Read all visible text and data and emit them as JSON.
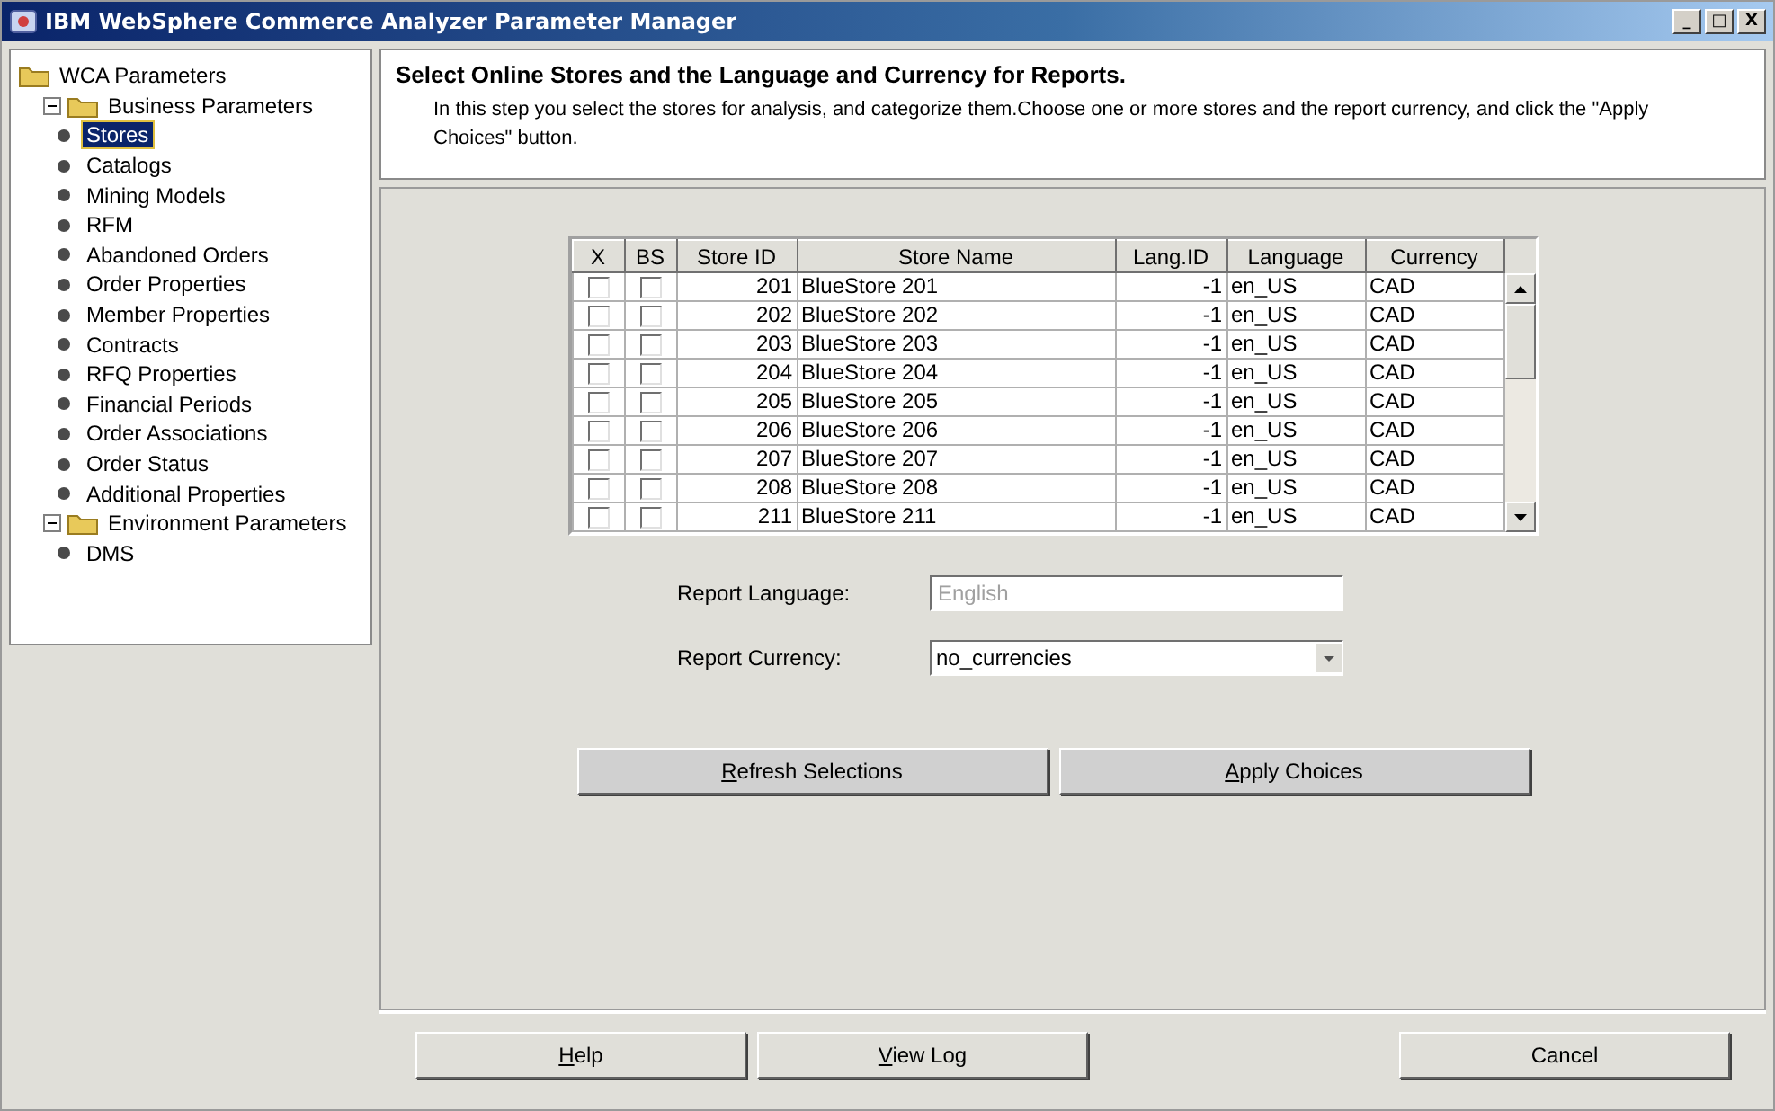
{
  "window": {
    "title": "IBM WebSphere Commerce Analyzer Parameter Manager",
    "controls": [
      "_",
      "□",
      "X"
    ]
  },
  "tree": {
    "label": "WCA Parameters",
    "children": [
      {
        "label": "Business Parameters",
        "expanded": true,
        "children": [
          {
            "label": "Stores",
            "selected": true
          },
          {
            "label": "Catalogs",
            "selected": false
          },
          {
            "label": "Mining Models",
            "selected": false
          },
          {
            "label": "RFM",
            "selected": false
          },
          {
            "label": "Abandoned Orders",
            "selected": false
          },
          {
            "label": "Order Properties",
            "selected": false
          },
          {
            "label": "Member Properties",
            "selected": false
          },
          {
            "label": "Contracts",
            "selected": false
          },
          {
            "label": "RFQ Properties",
            "selected": false
          },
          {
            "label": "Financial Periods",
            "selected": false
          },
          {
            "label": "Order Associations",
            "selected": false
          },
          {
            "label": "Order Status",
            "selected": false
          },
          {
            "label": "Additional Properties",
            "selected": false
          }
        ]
      },
      {
        "label": "Environment Parameters",
        "expanded": true,
        "children": [
          {
            "label": "DMS",
            "selected": false
          }
        ]
      }
    ]
  },
  "header": {
    "title": "Select Online Stores and the Language and Currency for Reports.",
    "description": "In this step you select the stores for analysis, and categorize them.Choose one or more stores and the report currency, and click the \"Apply Choices\" button."
  },
  "table": {
    "columns": [
      "X",
      "BS",
      "Store ID",
      "Store Name",
      "Lang.ID",
      "Language",
      "Currency"
    ],
    "rows": [
      {
        "x": false,
        "bs": false,
        "store_id": "201",
        "store_name": "BlueStore 201",
        "lang_id": "-1",
        "language": "en_US",
        "currency": "CAD"
      },
      {
        "x": false,
        "bs": false,
        "store_id": "202",
        "store_name": "BlueStore 202",
        "lang_id": "-1",
        "language": "en_US",
        "currency": "CAD"
      },
      {
        "x": false,
        "bs": false,
        "store_id": "203",
        "store_name": "BlueStore 203",
        "lang_id": "-1",
        "language": "en_US",
        "currency": "CAD"
      },
      {
        "x": false,
        "bs": false,
        "store_id": "204",
        "store_name": "BlueStore 204",
        "lang_id": "-1",
        "language": "en_US",
        "currency": "CAD"
      },
      {
        "x": false,
        "bs": false,
        "store_id": "205",
        "store_name": "BlueStore 205",
        "lang_id": "-1",
        "language": "en_US",
        "currency": "CAD"
      },
      {
        "x": false,
        "bs": false,
        "store_id": "206",
        "store_name": "BlueStore 206",
        "lang_id": "-1",
        "language": "en_US",
        "currency": "CAD"
      },
      {
        "x": false,
        "bs": false,
        "store_id": "207",
        "store_name": "BlueStore 207",
        "lang_id": "-1",
        "language": "en_US",
        "currency": "CAD"
      },
      {
        "x": false,
        "bs": false,
        "store_id": "208",
        "store_name": "BlueStore 208",
        "lang_id": "-1",
        "language": "en_US",
        "currency": "CAD"
      },
      {
        "x": false,
        "bs": false,
        "store_id": "211",
        "store_name": "BlueStore 211",
        "lang_id": "-1",
        "language": "en_US",
        "currency": "CAD"
      }
    ]
  },
  "form": [
    {
      "kind": "text",
      "label": "Report Language:",
      "value": "English",
      "disabled": true
    },
    {
      "kind": "select",
      "label": "Report Currency:",
      "value": "no_currencies",
      "disabled": false
    }
  ],
  "actions": [
    {
      "label": "Refresh Selections",
      "mnemonic_first": true
    },
    {
      "label": "Apply Choices",
      "mnemonic_first": true
    }
  ],
  "footer_buttons": [
    {
      "label": "Help",
      "mnemonic_first": true,
      "kind": "left"
    },
    {
      "label": "View Log",
      "mnemonic_first": true,
      "kind": "left"
    },
    {
      "label": "Cancel",
      "mnemonic_first": false,
      "kind": "right"
    }
  ]
}
